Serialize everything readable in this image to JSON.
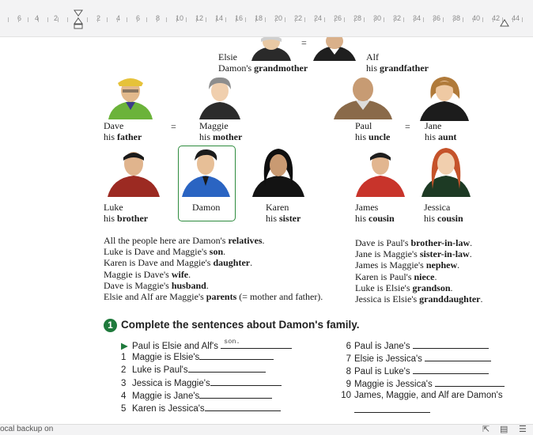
{
  "ruler": {
    "left_numbers": [
      "6",
      "4",
      "2"
    ],
    "right_numbers": [
      "2",
      "4",
      "6",
      "8",
      "10",
      "12",
      "14",
      "16",
      "18",
      "20",
      "22",
      "24",
      "26",
      "28",
      "30",
      "32",
      "34",
      "36",
      "38",
      "40",
      "42",
      "44"
    ]
  },
  "family_tree": {
    "grandparents": [
      {
        "name": "Elsie",
        "relation_prefix": "Damon's ",
        "relation": "grandmother"
      },
      {
        "name": "Alf",
        "relation_prefix": "his ",
        "relation": "grandfather"
      }
    ],
    "parents": [
      {
        "name": "Dave",
        "relation_prefix": "his ",
        "relation": "father"
      },
      {
        "name": "Maggie",
        "relation_prefix": "his ",
        "relation": "mother"
      }
    ],
    "uncle_aunt": [
      {
        "name": "Paul",
        "relation_prefix": "his ",
        "relation": "uncle"
      },
      {
        "name": "Jane",
        "relation_prefix": "his ",
        "relation": "aunt"
      }
    ],
    "children": [
      {
        "name": "Luke",
        "relation_prefix": "his ",
        "relation": "brother"
      },
      {
        "name": "Damon",
        "relation_prefix": "",
        "relation": ""
      },
      {
        "name": "Karen",
        "relation_prefix": "his ",
        "relation": "sister"
      }
    ],
    "cousins": [
      {
        "name": "James",
        "relation_prefix": "his ",
        "relation": "cousin"
      },
      {
        "name": "Jessica",
        "relation_prefix": "his ",
        "relation": "cousin"
      }
    ],
    "equals": "="
  },
  "facts_left": [
    {
      "pre": "All the people here are Damon's ",
      "bold": "relatives",
      "post": "."
    },
    {
      "pre": "Luke is Dave and Maggie's ",
      "bold": "son",
      "post": "."
    },
    {
      "pre": "Karen is Dave and Maggie's ",
      "bold": "daughter",
      "post": "."
    },
    {
      "pre": "Maggie is Dave's ",
      "bold": "wife",
      "post": "."
    },
    {
      "pre": "Dave is Maggie's ",
      "bold": "husband",
      "post": "."
    },
    {
      "pre": "Elsie and Alf are Maggie's ",
      "bold": "parents",
      "post": " (= mother and father)."
    }
  ],
  "facts_right": [
    {
      "pre": "Dave is Paul's ",
      "bold": "brother-in-law",
      "post": "."
    },
    {
      "pre": "Jane is Maggie's ",
      "bold": "sister-in-law",
      "post": "."
    },
    {
      "pre": "James is Maggie's ",
      "bold": "nephew",
      "post": "."
    },
    {
      "pre": "Karen is Paul's ",
      "bold": "niece",
      "post": "."
    },
    {
      "pre": "Luke is Elsie's ",
      "bold": "grandson",
      "post": "."
    },
    {
      "pre": "Jessica is Elsie's ",
      "bold": "granddaughter",
      "post": "."
    }
  ],
  "exercise": {
    "number": "1",
    "title": "Complete the sentences about Damon's family.",
    "example": {
      "text": "Paul is Elsie and Alf's",
      "answer": "son."
    },
    "left": [
      {
        "n": "1",
        "text": "Maggie is Elsie's"
      },
      {
        "n": "2",
        "text": "Luke is Paul's"
      },
      {
        "n": "3",
        "text": "Jessica is Maggie's"
      },
      {
        "n": "4",
        "text": "Maggie is Jane's"
      },
      {
        "n": "5",
        "text": "Karen is Jessica's"
      }
    ],
    "right": [
      {
        "n": "6",
        "text": "Paul is Jane's"
      },
      {
        "n": "7",
        "text": "Elsie is Jessica's"
      },
      {
        "n": "8",
        "text": "Paul is Luke's"
      },
      {
        "n": "9",
        "text": "Maggie is Jessica's"
      },
      {
        "n": "10",
        "text": "James, Maggie, and Alf are Damon's"
      }
    ]
  },
  "status_bar": {
    "text": "ocal backup on",
    "icons": [
      "fullscreen-icon",
      "page-view-icon",
      "list-view-icon"
    ]
  },
  "colors": {
    "accent_green": "#1f7a3c",
    "highlight_border": "#2e8b3e"
  }
}
